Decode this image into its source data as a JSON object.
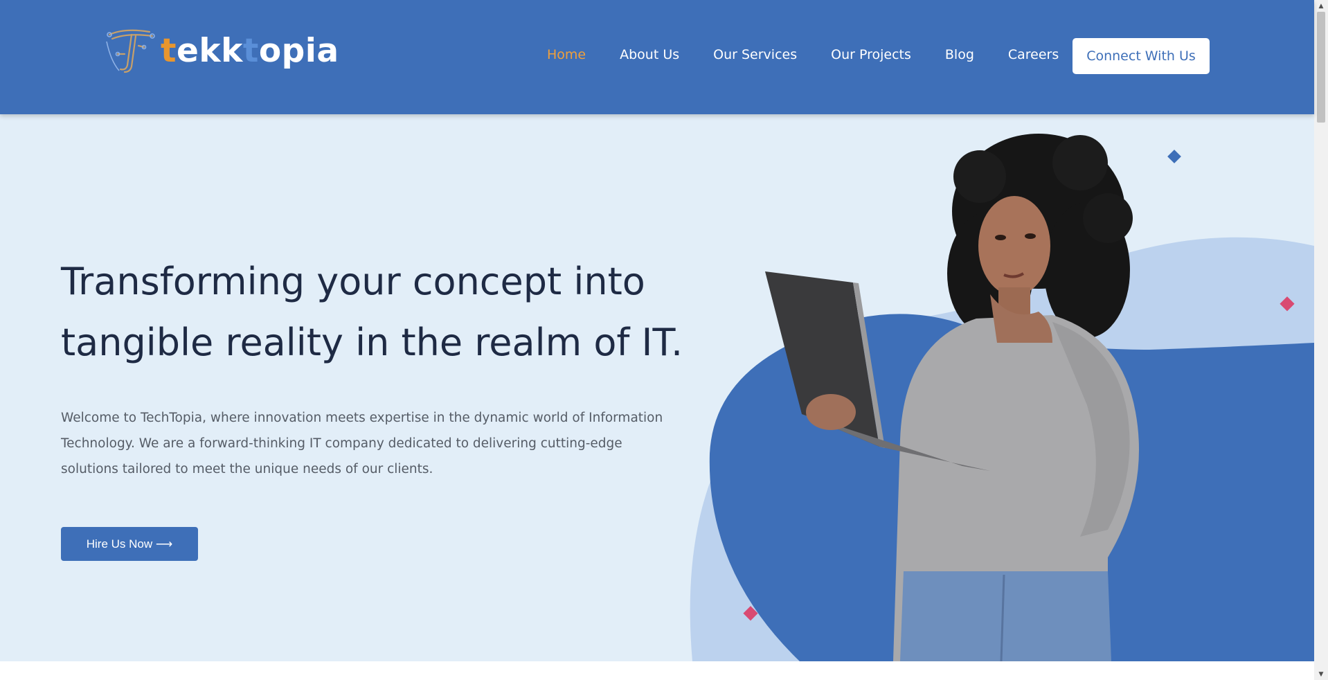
{
  "header": {
    "logo": {
      "prefix": "t",
      "part_a": "ekk",
      "accent_t": "t",
      "suffix": "opia"
    },
    "nav": [
      {
        "label": "Home",
        "active": true
      },
      {
        "label": "About Us"
      },
      {
        "label": "Our Services"
      },
      {
        "label": "Our Projects"
      },
      {
        "label": "Blog"
      },
      {
        "label": "Careers"
      }
    ],
    "cta_label": "Connect With Us"
  },
  "hero": {
    "title": "Transforming your concept into tangible reality in the realm of IT.",
    "description": "Welcome to TechTopia, where innovation meets expertise in the dynamic world of Information Technology. We are a forward-thinking IT company dedicated to delivering cutting-edge solutions tailored to meet the unique needs of our clients.",
    "button_label": "Hire Us Now ⟶"
  },
  "colors": {
    "brand_blue": "#3e6fb8",
    "accent_orange": "#f0a03c",
    "hero_bg": "#e2eef8",
    "heading": "#1e2a44",
    "decor_pink": "#d94a72"
  },
  "icons": {
    "logo_mark": "circuit-t-logo-icon",
    "scroll_up": "triangle-up-icon",
    "scroll_down": "triangle-down-icon"
  }
}
